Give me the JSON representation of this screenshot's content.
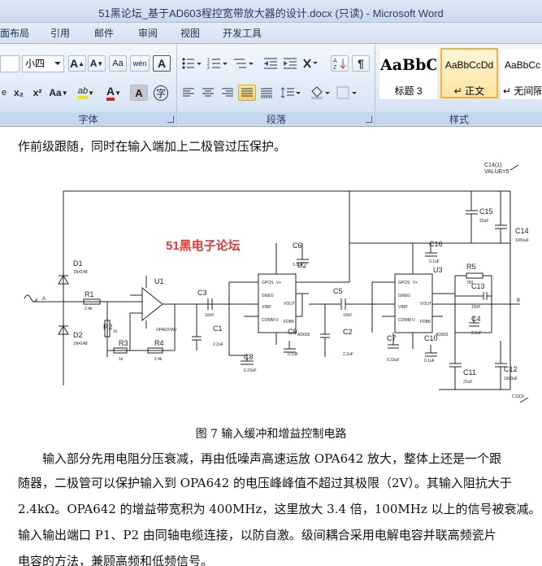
{
  "window": {
    "title": "51黑论坛_基于AD603程控宽带放大器的设计.docx (只读) - Microsoft Word"
  },
  "tabs": [
    "面布局",
    "引用",
    "邮件",
    "审阅",
    "视图",
    "开发工具"
  ],
  "ribbon": {
    "font_group": {
      "label": "字体",
      "font_size": "小四",
      "buttons": [
        "A",
        "A",
        "Aa",
        "wén",
        "A",
        "x₂",
        "x²",
        "Aa",
        "ab",
        "A",
        "A",
        "字"
      ]
    },
    "paragraph_group": {
      "label": "段落"
    },
    "styles_group": {
      "label": "样式",
      "styles": [
        {
          "sample": "AaBbC",
          "name": "标题 3"
        },
        {
          "sample": "AaBbCcDd",
          "name": "↵ 正文"
        },
        {
          "sample": "AaBbCc",
          "name": "↵ 无间隔"
        }
      ]
    }
  },
  "document": {
    "line_top": "作前级跟随，同时在输入端加上二极管过压保护。",
    "watermark": "51黑电子论坛",
    "caption": "图 7  输入缓冲和增益控制电路",
    "paragraph_lines": [
      "　　输入部分先用电阻分压衰减，再由低噪声高速运放 OPA642 放大，整体上还是一个跟",
      "随器，二极管可以保护输入到 OPA642 的电压峰峰值不超过其极限（2V）。其输入阻抗大于",
      "2.4kΩ。OPA642 的增益带宽积为 400MHz，这里放大 3.4 倍，100MHz 以上的信号被衰减。",
      "输入输出端口 P1、P2 由同轴电缆连接，以防自激。级间耦合采用电解电容并联高频瓷片",
      "电容的方法，兼顾高频和低频信号。"
    ]
  },
  "schematic": {
    "labels": {
      "C14_1": "C14(1)",
      "value": "VALUE=5",
      "D1": "D1",
      "D1_part": "1N4148",
      "D2": "D2",
      "D2_part": "1N4148",
      "A": "A",
      "B": "B",
      "R1": "R1",
      "R1_val": "2.4k",
      "R2": "R2",
      "R2_val": "1k",
      "R3": "R3",
      "R3_val": "1k",
      "R4": "R4",
      "R4_val": "2.4k",
      "U1": "U1",
      "U1_part": "OPA637AU",
      "C3": "C3",
      "C3_val": "10nF",
      "C1": "C1",
      "C1_val": "2.2uF",
      "C6": "C6",
      "C6_val": "0.1uF",
      "D2b": "D2",
      "C8": "C8",
      "C8_val": "0.33uF",
      "C9": "C9",
      "C9_val": "0.1uF",
      "AD603": "AD603",
      "C5": "C5",
      "C5_val": "10nF",
      "C2": "C2",
      "C2_val": "2.2uF",
      "C16": "C16",
      "C16_val": "0.1uF",
      "U3": "U3",
      "C7": "C7",
      "C7_val": "0.33uF",
      "C10": "C10",
      "C10_val": "0.1uF",
      "R5": "R5",
      "R5_val": "750",
      "C13": "C13",
      "C13_val": "10nF",
      "C4": "C4",
      "C4_val": "2.2uF",
      "C15": "C15",
      "C15_val": "22uF",
      "C14": "C14",
      "C14_val": "1000uF",
      "C11": "C11",
      "C11_val": "22uF",
      "C12": "C12",
      "C12_val": "1000uF",
      "C12_2": "C12(2)",
      "pin_gpos": "GPOS",
      "pin_vp": "V+",
      "pin_gneg": "GNEG",
      "pin_vout": "VOUT",
      "pin_vinp": "VINP",
      "pin_comm": "COMM",
      "pin_vm": "V-",
      "pin_fdbk": "FDBK"
    }
  }
}
